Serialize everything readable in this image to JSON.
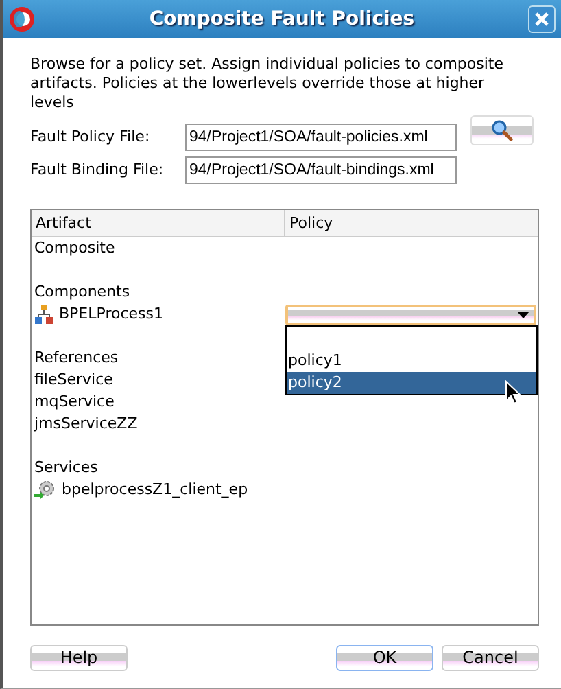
{
  "window": {
    "title": "Composite Fault Policies"
  },
  "description": "Browse for a policy set. Assign individual policies to composite artifacts. Policies at the lowerlevels override those at higher levels",
  "fields": [
    {
      "label": "Fault Policy File:",
      "value": "94/Project1/SOA/fault-policies.xml"
    },
    {
      "label": "Fault Binding File:",
      "value": "94/Project1/SOA/fault-bindings.xml"
    }
  ],
  "table": {
    "columns": [
      "Artifact",
      "Policy"
    ],
    "sections": [
      {
        "label": "Composite"
      },
      {
        "label": "Components",
        "items": [
          {
            "name": "BPELProcess1",
            "kind": "process",
            "policy": {
              "expanded": true,
              "options": [
                {
                  "label": "policy1",
                  "selected": false
                },
                {
                  "label": "policy2",
                  "selected": true
                }
              ]
            }
          }
        ]
      },
      {
        "label": "References",
        "items": [
          {
            "name": "fileService",
            "kind": "plain"
          },
          {
            "name": "mqService",
            "kind": "plain"
          },
          {
            "name": "jmsServiceZZ",
            "kind": "plain"
          }
        ]
      },
      {
        "label": "Services",
        "items": [
          {
            "name": "bpelprocessZ1_client_ep",
            "kind": "service"
          }
        ]
      }
    ]
  },
  "buttons": {
    "left": [
      {
        "label": "Help",
        "default": false
      }
    ],
    "right": [
      {
        "label": "OK",
        "default": true
      },
      {
        "label": "Cancel",
        "default": false
      }
    ]
  }
}
